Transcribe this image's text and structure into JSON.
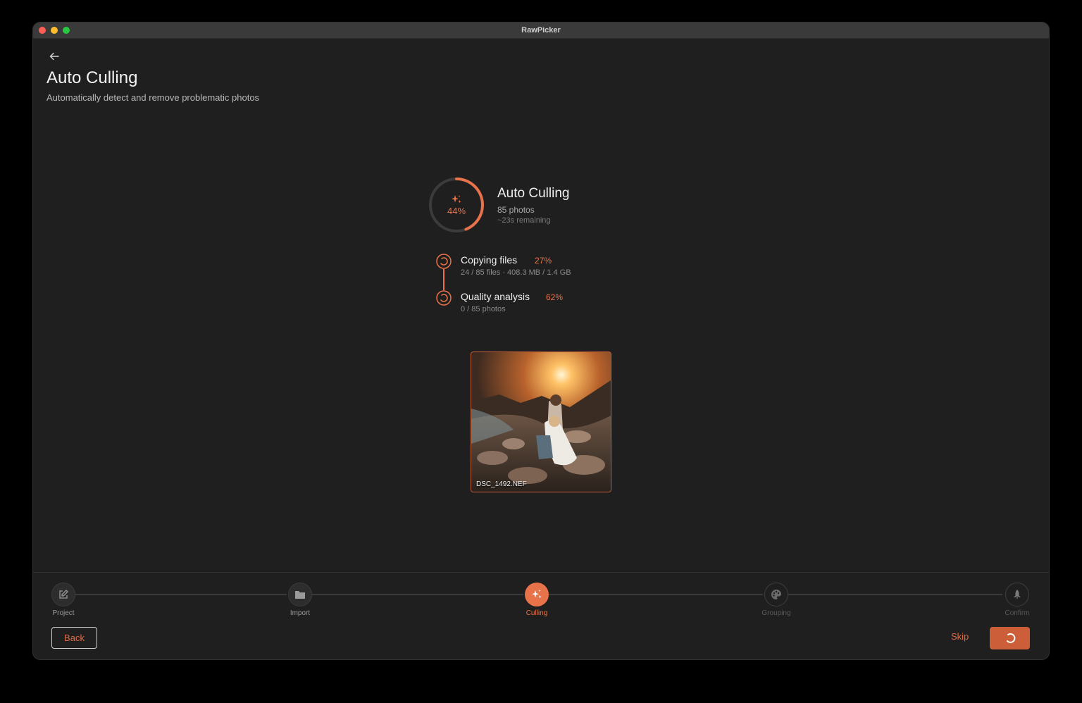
{
  "window": {
    "title": "RawPicker"
  },
  "header": {
    "back_icon": "arrow-left-icon",
    "title": "Auto Culling",
    "subtitle": "Automatically detect and remove problematic photos"
  },
  "job": {
    "progress_percent": 44,
    "progress_label": "44%",
    "title": "Auto Culling",
    "count": "85 photos",
    "remaining": "~23s remaining"
  },
  "tasks": [
    {
      "name": "Copying files",
      "percent_label": "27%",
      "percent": 27,
      "detail": "24 / 85 files · 408.3 MB / 1.4 GB"
    },
    {
      "name": "Quality analysis",
      "percent_label": "62%",
      "percent": 62,
      "detail": "0 / 85 photos"
    }
  ],
  "preview": {
    "filename": "DSC_1492.NEF"
  },
  "stepper": [
    {
      "label": "Project",
      "state": "done",
      "icon": "edit-icon"
    },
    {
      "label": "Import",
      "state": "done",
      "icon": "folder-icon"
    },
    {
      "label": "Culling",
      "state": "active",
      "icon": "sparkles-icon"
    },
    {
      "label": "Grouping",
      "state": "future",
      "icon": "palette-icon"
    },
    {
      "label": "Confirm",
      "state": "future",
      "icon": "rocket-icon"
    }
  ],
  "footer": {
    "back_label": "Back",
    "skip_label": "Skip",
    "primary_icon": "spinner-icon"
  },
  "colors": {
    "accent": "#e8734a",
    "background": "#1f1f1f",
    "button": "#cc5e3a"
  }
}
